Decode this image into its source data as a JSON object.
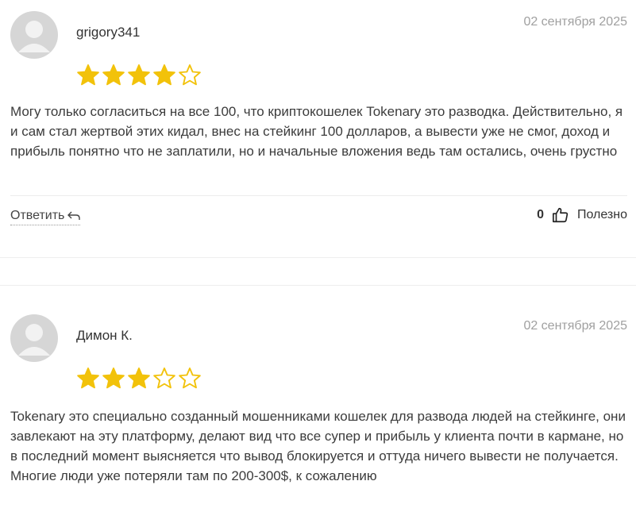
{
  "reviews": [
    {
      "author": "grigory341",
      "date": "02 сентября 2025",
      "rating": 4,
      "text": "Могу только согласиться на все 100, что криптокошелек Tokenary это разводка. Действительно, я и сам стал жертвой этих кидал, внес на стейкинг 100 долларов, а вывести уже не смог, доход и прибыль понятно что не заплатили, но и начальные вложения ведь там остались, очень грустно",
      "reply_label": "Ответить",
      "helpful_count": "0",
      "helpful_label": "Полезно"
    },
    {
      "author": "Димон К.",
      "date": "02 сентября 2025",
      "rating": 3,
      "text": "Tokenary это специально созданный мошенниками кошелек для развода людей на стейкинге, они завлекают на эту платформу, делают вид что все супер и прибыль у клиента почти в кармане, но в последний момент выясняется что вывод блокируется и оттуда ничего вывести не получается. Многие люди уже потеряли там по 200-300$, к сожалению"
    }
  ],
  "rating_max": 5,
  "colors": {
    "star": "#f2c20a",
    "avatar": "#d6d6d6",
    "date": "#a0a0a0"
  },
  "icons": {
    "star": "star-icon",
    "reply": "reply-arrow-icon",
    "thumb": "thumbs-up-icon"
  }
}
